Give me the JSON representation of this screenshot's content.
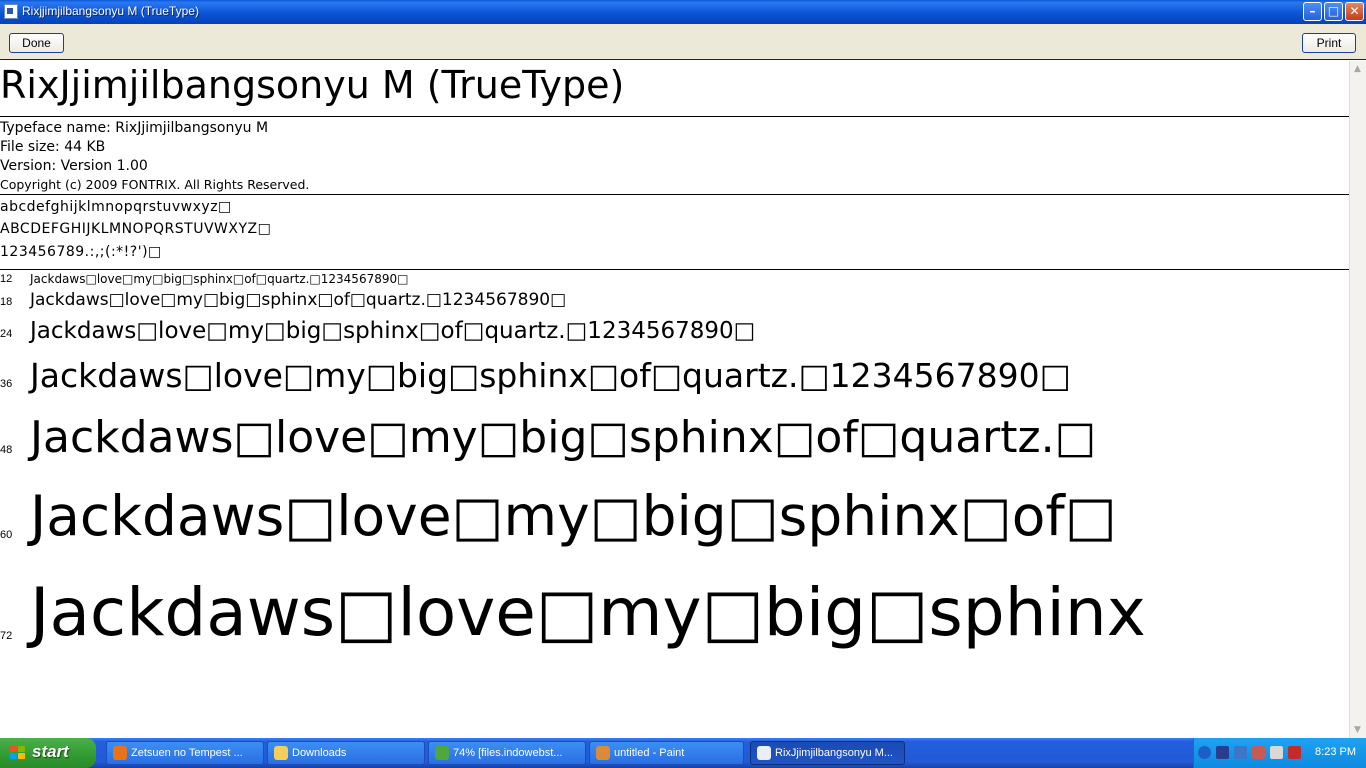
{
  "window": {
    "title": "Rixjjimjilbangsonyu M (TrueType)",
    "buttons": {
      "minimize": "–",
      "maximize": "□",
      "close": "✕"
    }
  },
  "toolbar": {
    "done_label": "Done",
    "print_label": "Print"
  },
  "font": {
    "heading": "RixJjimjilbangsonyu M (TrueType)",
    "typeface_line": "Typeface name: RixJjimjilbangsonyu M",
    "file_size_line": "File size: 44 KB",
    "version_line": "Version: Version 1.00",
    "copyright_line": "Copyright (c) 2009 FONTRIX. All Rights Reserved.",
    "charset_lower": "abcdefghijklmnopqrstuvwxyz□",
    "charset_upper": "ABCDEFGHIJKLMNOPQRSTUVWXYZ□",
    "charset_digits": "123456789.:,;(:*!?')□"
  },
  "samples": [
    {
      "size": "12",
      "text": "Jackdaws□love□my□big□sphinx□of□quartz.□1234567890□"
    },
    {
      "size": "18",
      "text": "Jackdaws□love□my□big□sphinx□of□quartz.□1234567890□"
    },
    {
      "size": "24",
      "text": "Jackdaws□love□my□big□sphinx□of□quartz.□1234567890□"
    },
    {
      "size": "36",
      "text": "Jackdaws□love□my□big□sphinx□of□quartz.□1234567890□"
    },
    {
      "size": "48",
      "text": "Jackdaws□love□my□big□sphinx□of□quartz.□"
    },
    {
      "size": "60",
      "text": "Jackdaws□love□my□big□sphinx□of□"
    },
    {
      "size": "72",
      "text": "Jackdaws□love□my□big□sphinx"
    }
  ],
  "taskbar": {
    "start_label": "start",
    "tasks": [
      {
        "label": "Zetsuen no Tempest ...",
        "icon": "firefox-icon",
        "color": "#e8731c"
      },
      {
        "label": "Downloads",
        "icon": "folder-icon",
        "color": "#f2cf5b"
      },
      {
        "label": "74% [files.indowebst...",
        "icon": "download-manager-icon",
        "color": "#4fa83d"
      },
      {
        "label": "untitled - Paint",
        "icon": "paint-icon",
        "color": "#d98b3a"
      },
      {
        "label": "RixJjimjilbangsonyu M...",
        "icon": "font-viewer-icon",
        "color": "#e9eef8"
      }
    ],
    "clock": "8:23 PM"
  }
}
